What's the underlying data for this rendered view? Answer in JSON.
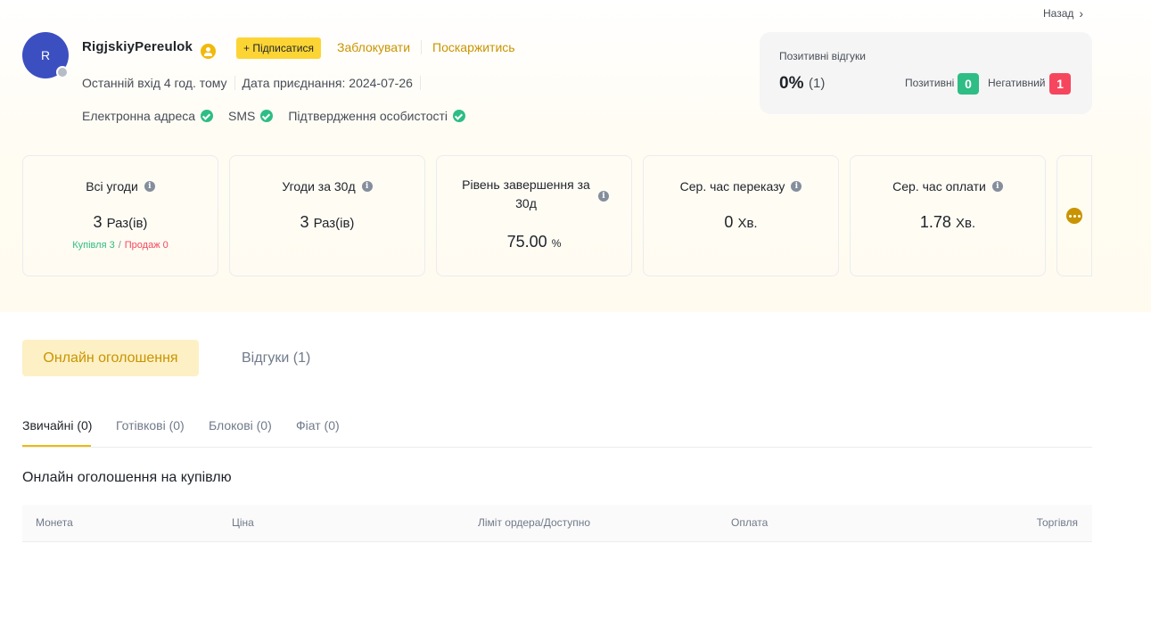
{
  "back": {
    "label": "Назад"
  },
  "profile": {
    "avatar_letter": "R",
    "username": "RigjskiyPereulok",
    "follow_label": "+ Підписатися",
    "block_label": "Заблокувати",
    "report_label": "Поскаржитись",
    "last_login": "Останній вхід 4 год. тому",
    "join_date": "Дата приєднання: 2024-07-26",
    "verifications": [
      "Електронна адреса",
      "SMS",
      "Підтвердження особистості"
    ]
  },
  "feedback": {
    "title": "Позитивні відгуки",
    "percent": "0%",
    "count": "(1)",
    "positive_label": "Позитивні",
    "positive_value": "0",
    "negative_label": "Негативний",
    "negative_value": "1"
  },
  "stats": [
    {
      "label": "Всі угоди",
      "value": "3",
      "unit": "Раз(ів)",
      "buy": "Купівля 3",
      "sell": "Продаж 0"
    },
    {
      "label": "Угоди за 30д",
      "value": "3",
      "unit": "Раз(ів)"
    },
    {
      "label": "Рівень завершення за 30д",
      "value": "75.00",
      "unit": "%"
    },
    {
      "label": "Сер. час переказу",
      "value": "0",
      "unit": "Хв."
    },
    {
      "label": "Сер. час оплати",
      "value": "1.78",
      "unit": "Хв."
    }
  ],
  "tabs": {
    "online_ads": "Онлайн оголошення",
    "reviews": "Відгуки (1)"
  },
  "sub_tabs": [
    "Звичайні (0)",
    "Готівкові (0)",
    "Блокові (0)",
    "Фіат (0)"
  ],
  "section_title": "Онлайн оголошення на купівлю",
  "table": {
    "columns": [
      "Монета",
      "Ціна",
      "Ліміт ордера/Доступно",
      "Оплата",
      "Торгівля"
    ]
  },
  "colors": {
    "accent": "#f0b90b",
    "link": "#c99400",
    "positive": "#2ebd85",
    "negative": "#f6465d",
    "avatar": "#3c4fc1"
  }
}
